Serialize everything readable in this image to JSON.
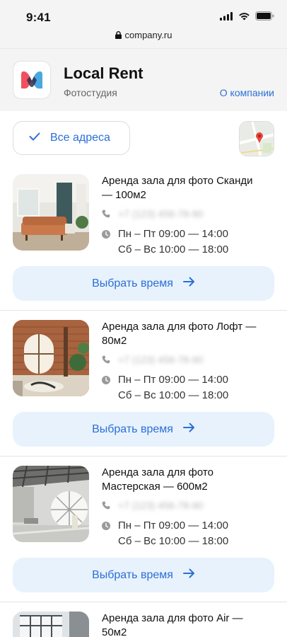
{
  "status_bar": {
    "time": "9:41"
  },
  "browser": {
    "url": "company.ru"
  },
  "header": {
    "brand": "Local Rent",
    "subtitle": "Фотостудия",
    "about_link": "О компании"
  },
  "filter": {
    "label": "Все адреса"
  },
  "colors": {
    "accent": "#2b6fd6",
    "button_bg": "#e8f2fd",
    "logo_red": "#f0505f",
    "logo_blue": "#4aa8e0"
  },
  "listings": [
    {
      "title": "Аренда зала для фото Сканди — 100м2",
      "phone": "+7 (123) 456-78-90",
      "hours_weekday": "Пн – Пт  09:00 — 14:00",
      "hours_weekend": "Сб – Вс  10:00 — 18:00",
      "cta": "Выбрать время"
    },
    {
      "title": "Аренда зала для фото Лофт — 80м2",
      "phone": "+7 (123) 456-78-90",
      "hours_weekday": "Пн – Пт  09:00 — 14:00",
      "hours_weekend": "Сб – Вс  10:00 — 18:00",
      "cta": "Выбрать время"
    },
    {
      "title": "Аренда зала для фото Мастерская — 600м2",
      "phone": "+7 (123) 456-78-90",
      "hours_weekday": "Пн – Пт  09:00 — 14:00",
      "hours_weekend": "Сб – Вс  10:00 — 18:00",
      "cta": "Выбрать время"
    },
    {
      "title": "Аренда зала для фото Air — 50м2"
    }
  ]
}
